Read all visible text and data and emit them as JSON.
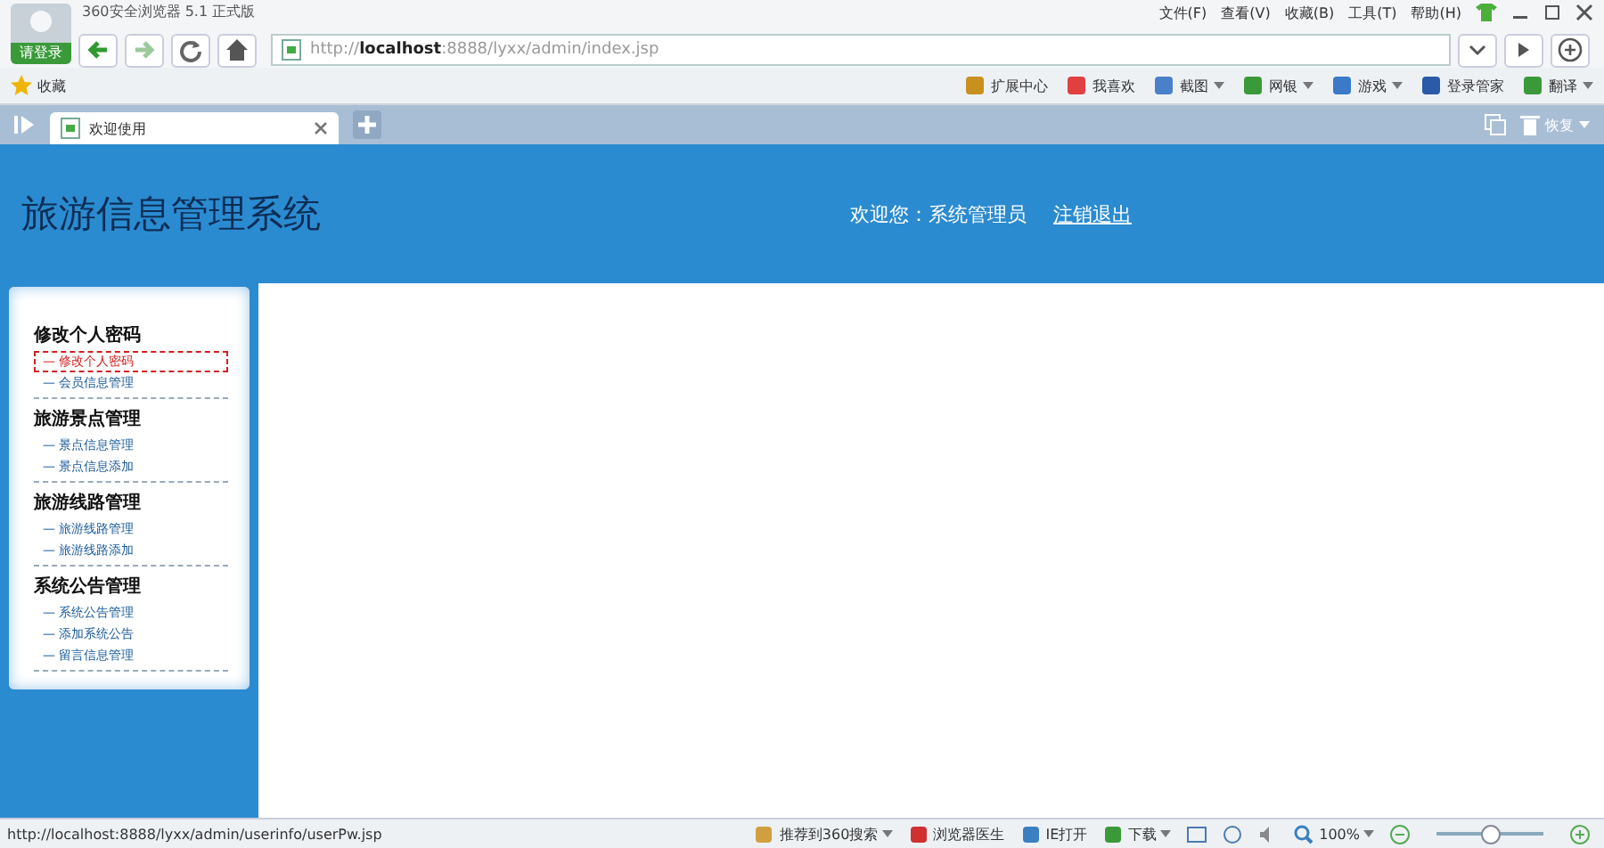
{
  "browser": {
    "title": "360安全浏览器 5.1 正式版",
    "login_label": "请登录",
    "menu": [
      "文件(F)",
      "查看(V)",
      "收藏(B)",
      "工具(T)",
      "帮助(H)"
    ],
    "address": {
      "prefix": "http://",
      "host": "localhost",
      "rest": ":8888/lyxx/admin/index.jsp"
    },
    "bookmarks_label": "收藏",
    "toolbar_items": [
      {
        "label": "扩展中心",
        "dropdown": false
      },
      {
        "label": "我喜欢",
        "dropdown": false
      },
      {
        "label": "截图",
        "dropdown": true
      },
      {
        "label": "网银",
        "dropdown": true
      },
      {
        "label": "游戏",
        "dropdown": true
      },
      {
        "label": "登录管家",
        "dropdown": false
      },
      {
        "label": "翻译",
        "dropdown": true
      }
    ],
    "tabs": [
      {
        "label": "欢迎使用",
        "selected": true
      }
    ],
    "restore_label": "恢复"
  },
  "header": {
    "title": "旅游信息管理系统",
    "welcome": "欢迎您：系统管理员",
    "logout": "注销退出"
  },
  "sidebar": [
    {
      "title": "修改个人密码",
      "items": [
        {
          "label": "— 修改个人密码",
          "selected": true
        },
        {
          "label": "— 会员信息管理",
          "selected": false
        }
      ]
    },
    {
      "title": "旅游景点管理",
      "items": [
        {
          "label": "— 景点信息管理",
          "selected": false
        },
        {
          "label": "— 景点信息添加",
          "selected": false
        }
      ]
    },
    {
      "title": "旅游线路管理",
      "items": [
        {
          "label": "— 旅游线路管理",
          "selected": false
        },
        {
          "label": "— 旅游线路添加",
          "selected": false
        }
      ]
    },
    {
      "title": "系统公告管理",
      "items": [
        {
          "label": "— 系统公告管理",
          "selected": false
        },
        {
          "label": "— 添加系统公告",
          "selected": false
        },
        {
          "label": "— 留言信息管理",
          "selected": false
        }
      ]
    }
  ],
  "status_bar": {
    "url": "http://localhost:8888/lyxx/admin/userinfo/userPw.jsp",
    "items": [
      {
        "label": "推荐到360搜索",
        "dropdown": true
      },
      {
        "label": "浏览器医生",
        "dropdown": false
      },
      {
        "label": "IE打开",
        "dropdown": false
      },
      {
        "label": "下载",
        "dropdown": true
      }
    ],
    "zoom": "100%",
    "zoom_slider": {
      "level": 0.5
    }
  }
}
